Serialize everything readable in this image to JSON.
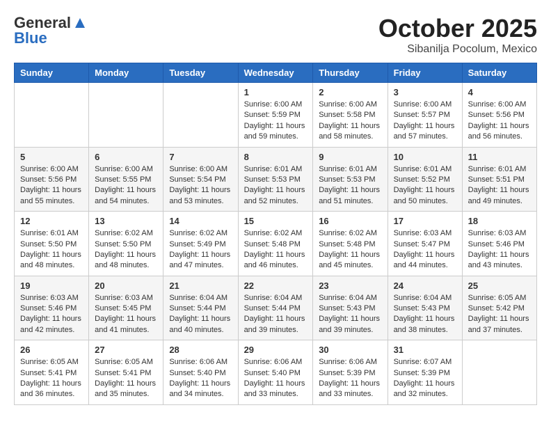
{
  "header": {
    "logo_line1": "General",
    "logo_line2": "Blue",
    "month_title": "October 2025",
    "subtitle": "Sibanilja Pocolum, Mexico"
  },
  "weekdays": [
    "Sunday",
    "Monday",
    "Tuesday",
    "Wednesday",
    "Thursday",
    "Friday",
    "Saturday"
  ],
  "weeks": [
    [
      {
        "day": "",
        "info": ""
      },
      {
        "day": "",
        "info": ""
      },
      {
        "day": "",
        "info": ""
      },
      {
        "day": "1",
        "info": "Sunrise: 6:00 AM\nSunset: 5:59 PM\nDaylight: 11 hours\nand 59 minutes."
      },
      {
        "day": "2",
        "info": "Sunrise: 6:00 AM\nSunset: 5:58 PM\nDaylight: 11 hours\nand 58 minutes."
      },
      {
        "day": "3",
        "info": "Sunrise: 6:00 AM\nSunset: 5:57 PM\nDaylight: 11 hours\nand 57 minutes."
      },
      {
        "day": "4",
        "info": "Sunrise: 6:00 AM\nSunset: 5:56 PM\nDaylight: 11 hours\nand 56 minutes."
      }
    ],
    [
      {
        "day": "5",
        "info": "Sunrise: 6:00 AM\nSunset: 5:56 PM\nDaylight: 11 hours\nand 55 minutes."
      },
      {
        "day": "6",
        "info": "Sunrise: 6:00 AM\nSunset: 5:55 PM\nDaylight: 11 hours\nand 54 minutes."
      },
      {
        "day": "7",
        "info": "Sunrise: 6:00 AM\nSunset: 5:54 PM\nDaylight: 11 hours\nand 53 minutes."
      },
      {
        "day": "8",
        "info": "Sunrise: 6:01 AM\nSunset: 5:53 PM\nDaylight: 11 hours\nand 52 minutes."
      },
      {
        "day": "9",
        "info": "Sunrise: 6:01 AM\nSunset: 5:53 PM\nDaylight: 11 hours\nand 51 minutes."
      },
      {
        "day": "10",
        "info": "Sunrise: 6:01 AM\nSunset: 5:52 PM\nDaylight: 11 hours\nand 50 minutes."
      },
      {
        "day": "11",
        "info": "Sunrise: 6:01 AM\nSunset: 5:51 PM\nDaylight: 11 hours\nand 49 minutes."
      }
    ],
    [
      {
        "day": "12",
        "info": "Sunrise: 6:01 AM\nSunset: 5:50 PM\nDaylight: 11 hours\nand 48 minutes."
      },
      {
        "day": "13",
        "info": "Sunrise: 6:02 AM\nSunset: 5:50 PM\nDaylight: 11 hours\nand 48 minutes."
      },
      {
        "day": "14",
        "info": "Sunrise: 6:02 AM\nSunset: 5:49 PM\nDaylight: 11 hours\nand 47 minutes."
      },
      {
        "day": "15",
        "info": "Sunrise: 6:02 AM\nSunset: 5:48 PM\nDaylight: 11 hours\nand 46 minutes."
      },
      {
        "day": "16",
        "info": "Sunrise: 6:02 AM\nSunset: 5:48 PM\nDaylight: 11 hours\nand 45 minutes."
      },
      {
        "day": "17",
        "info": "Sunrise: 6:03 AM\nSunset: 5:47 PM\nDaylight: 11 hours\nand 44 minutes."
      },
      {
        "day": "18",
        "info": "Sunrise: 6:03 AM\nSunset: 5:46 PM\nDaylight: 11 hours\nand 43 minutes."
      }
    ],
    [
      {
        "day": "19",
        "info": "Sunrise: 6:03 AM\nSunset: 5:46 PM\nDaylight: 11 hours\nand 42 minutes."
      },
      {
        "day": "20",
        "info": "Sunrise: 6:03 AM\nSunset: 5:45 PM\nDaylight: 11 hours\nand 41 minutes."
      },
      {
        "day": "21",
        "info": "Sunrise: 6:04 AM\nSunset: 5:44 PM\nDaylight: 11 hours\nand 40 minutes."
      },
      {
        "day": "22",
        "info": "Sunrise: 6:04 AM\nSunset: 5:44 PM\nDaylight: 11 hours\nand 39 minutes."
      },
      {
        "day": "23",
        "info": "Sunrise: 6:04 AM\nSunset: 5:43 PM\nDaylight: 11 hours\nand 39 minutes."
      },
      {
        "day": "24",
        "info": "Sunrise: 6:04 AM\nSunset: 5:43 PM\nDaylight: 11 hours\nand 38 minutes."
      },
      {
        "day": "25",
        "info": "Sunrise: 6:05 AM\nSunset: 5:42 PM\nDaylight: 11 hours\nand 37 minutes."
      }
    ],
    [
      {
        "day": "26",
        "info": "Sunrise: 6:05 AM\nSunset: 5:41 PM\nDaylight: 11 hours\nand 36 minutes."
      },
      {
        "day": "27",
        "info": "Sunrise: 6:05 AM\nSunset: 5:41 PM\nDaylight: 11 hours\nand 35 minutes."
      },
      {
        "day": "28",
        "info": "Sunrise: 6:06 AM\nSunset: 5:40 PM\nDaylight: 11 hours\nand 34 minutes."
      },
      {
        "day": "29",
        "info": "Sunrise: 6:06 AM\nSunset: 5:40 PM\nDaylight: 11 hours\nand 33 minutes."
      },
      {
        "day": "30",
        "info": "Sunrise: 6:06 AM\nSunset: 5:39 PM\nDaylight: 11 hours\nand 33 minutes."
      },
      {
        "day": "31",
        "info": "Sunrise: 6:07 AM\nSunset: 5:39 PM\nDaylight: 11 hours\nand 32 minutes."
      },
      {
        "day": "",
        "info": ""
      }
    ]
  ]
}
